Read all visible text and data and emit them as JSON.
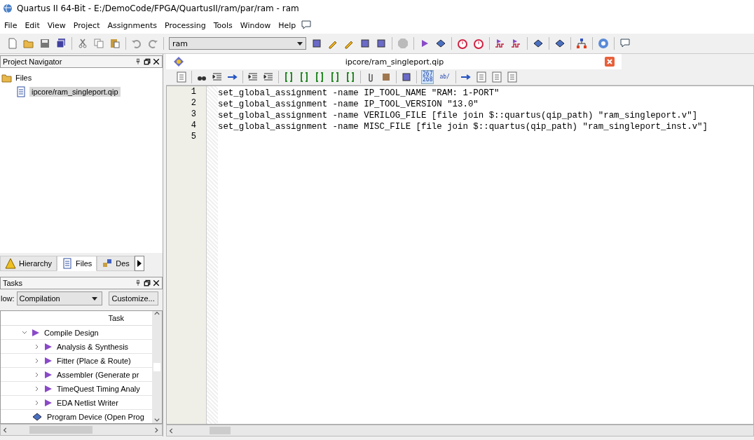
{
  "window": {
    "title": "Quartus II 64-Bit - E:/DemoCode/FPGA/QuartusII/ram/par/ram - ram"
  },
  "menu": [
    "File",
    "Edit",
    "View",
    "Project",
    "Assignments",
    "Processing",
    "Tools",
    "Window",
    "Help"
  ],
  "toolbar": {
    "project_combo": "ram"
  },
  "project_navigator": {
    "title": "Project Navigator",
    "tree": [
      {
        "label": "Files",
        "children": [
          {
            "label": "ipcore/ram_singleport.qip",
            "selected": true
          }
        ]
      }
    ],
    "tabs": [
      {
        "label": "Hierarchy",
        "selected": false
      },
      {
        "label": "Files",
        "selected": true
      },
      {
        "label": "Des",
        "selected": false
      }
    ]
  },
  "tasks": {
    "title": "Tasks",
    "flow_label": "low:",
    "flow": "Compilation",
    "customize": "Customize...",
    "column": "Task",
    "items": [
      {
        "label": "Compile Design",
        "expanded": true,
        "children": [
          {
            "label": "Analysis & Synthesis",
            "expanded": false
          },
          {
            "label": "Fitter (Place & Route)",
            "expanded": false
          },
          {
            "label": "Assembler (Generate pr",
            "expanded": false
          },
          {
            "label": "TimeQuest Timing Analy",
            "expanded": false
          },
          {
            "label": "EDA Netlist Writer",
            "expanded": false
          }
        ]
      },
      {
        "label": "Program Device (Open Prog",
        "kind": "program"
      }
    ]
  },
  "editor": {
    "tab": "ipcore/ram_singleport.qip",
    "toolbar": [
      {
        "label": "267",
        "label2": "268",
        "selected": true
      },
      {
        "label": "ab/",
        "selected": false
      }
    ],
    "lines": [
      {
        "number": "1",
        "text": "set_global_assignment -name IP_TOOL_NAME \"RAM: 1-PORT\""
      },
      {
        "number": "2",
        "text": "set_global_assignment -name IP_TOOL_VERSION \"13.0\""
      },
      {
        "number": "3",
        "text": "set_global_assignment -name VERILOG_FILE [file join $::quartus(qip_path) \"ram_singleport.v\"]"
      },
      {
        "number": "4",
        "text": "set_global_assignment -name MISC_FILE [file join $::quartus(qip_path) \"ram_singleport_inst.v\"]"
      },
      {
        "number": "5"
      }
    ]
  }
}
